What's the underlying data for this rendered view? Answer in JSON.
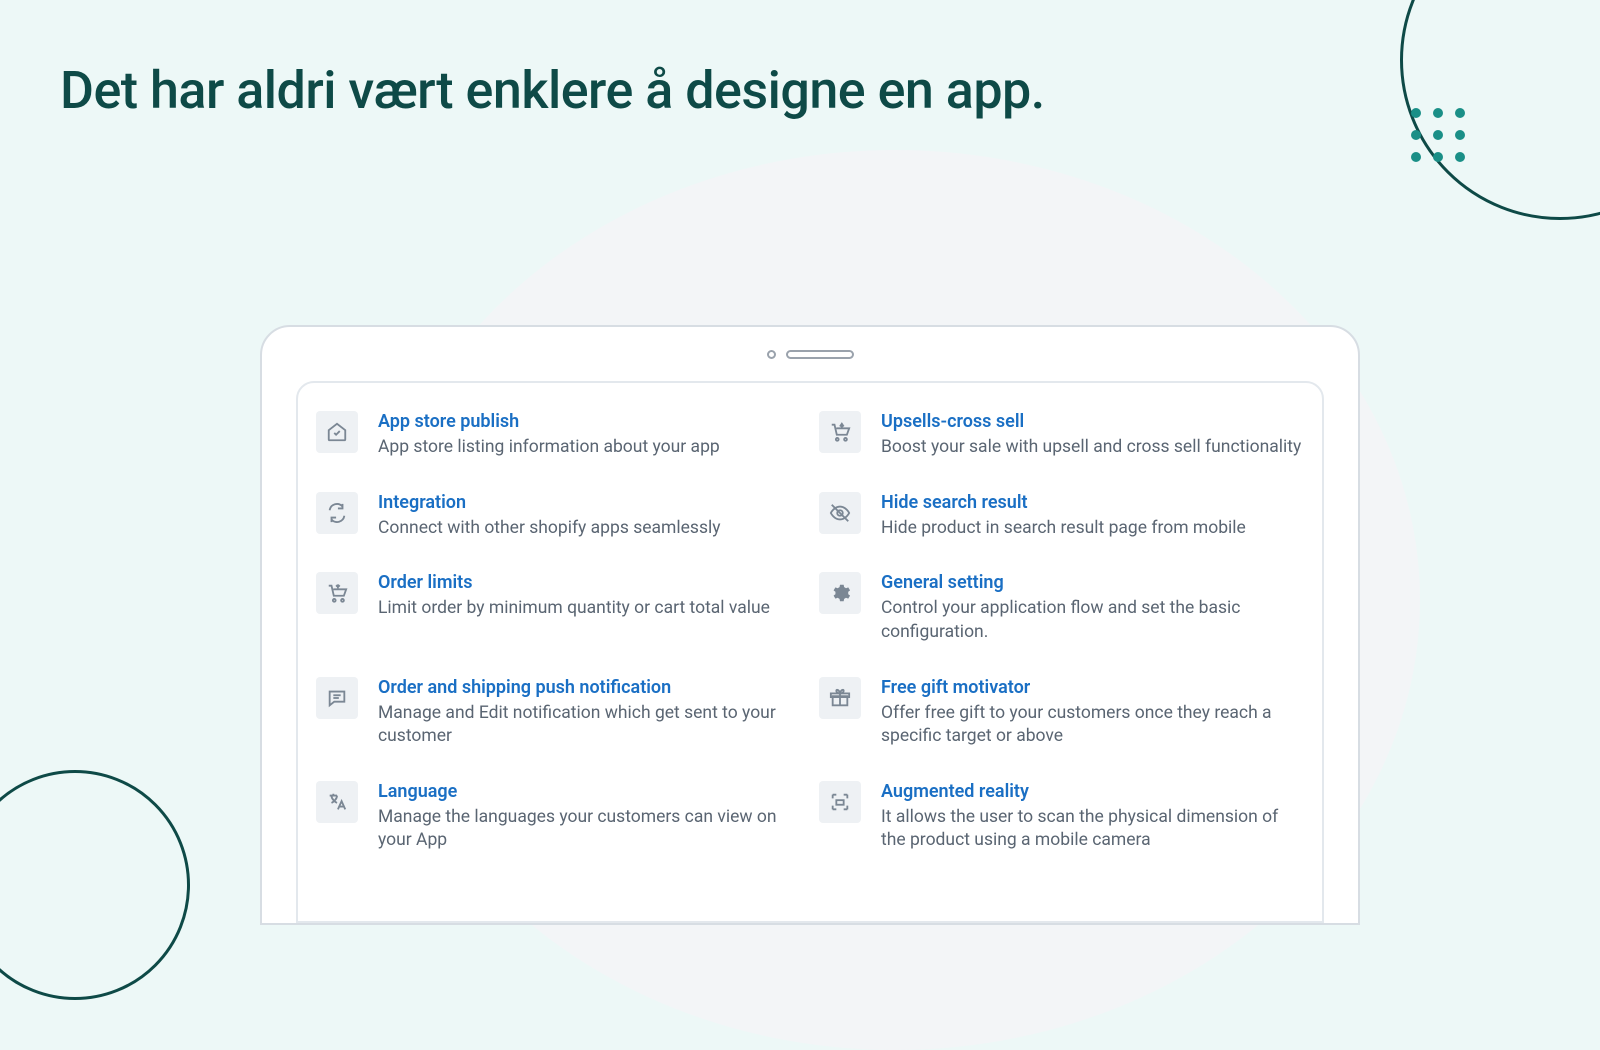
{
  "heading": "Det har aldri vært enklere å designe en app.",
  "features": [
    {
      "title": "App store publish",
      "desc": "App store listing information about your app",
      "icon": "house-check"
    },
    {
      "title": "Upsells-cross sell",
      "desc": "Boost your sale with upsell and cross sell functionality",
      "icon": "cart-arrow"
    },
    {
      "title": "Integration",
      "desc": "Connect with other shopify apps seamlessly",
      "icon": "arrows-cycle"
    },
    {
      "title": "Hide search result",
      "desc": "Hide product in search result page from mobile",
      "icon": "eye-slash"
    },
    {
      "title": "Order limits",
      "desc": "Limit order by minimum quantity or cart total value",
      "icon": "cart-limit"
    },
    {
      "title": "General setting",
      "desc": "Control your application flow and set the basic configuration.",
      "icon": "gear"
    },
    {
      "title": "Order and shipping push notification",
      "desc": "Manage and Edit notification which get sent to your customer",
      "icon": "chat"
    },
    {
      "title": "Free gift motivator",
      "desc": "Offer free gift to your customers once they reach a specific target or above",
      "icon": "gift"
    },
    {
      "title": "Language",
      "desc": "Manage the languages your customers can view on your App",
      "icon": "translate"
    },
    {
      "title": "Augmented reality",
      "desc": "It allows the user to scan the physical dimension of the product using a mobile camera",
      "icon": "ar"
    }
  ]
}
